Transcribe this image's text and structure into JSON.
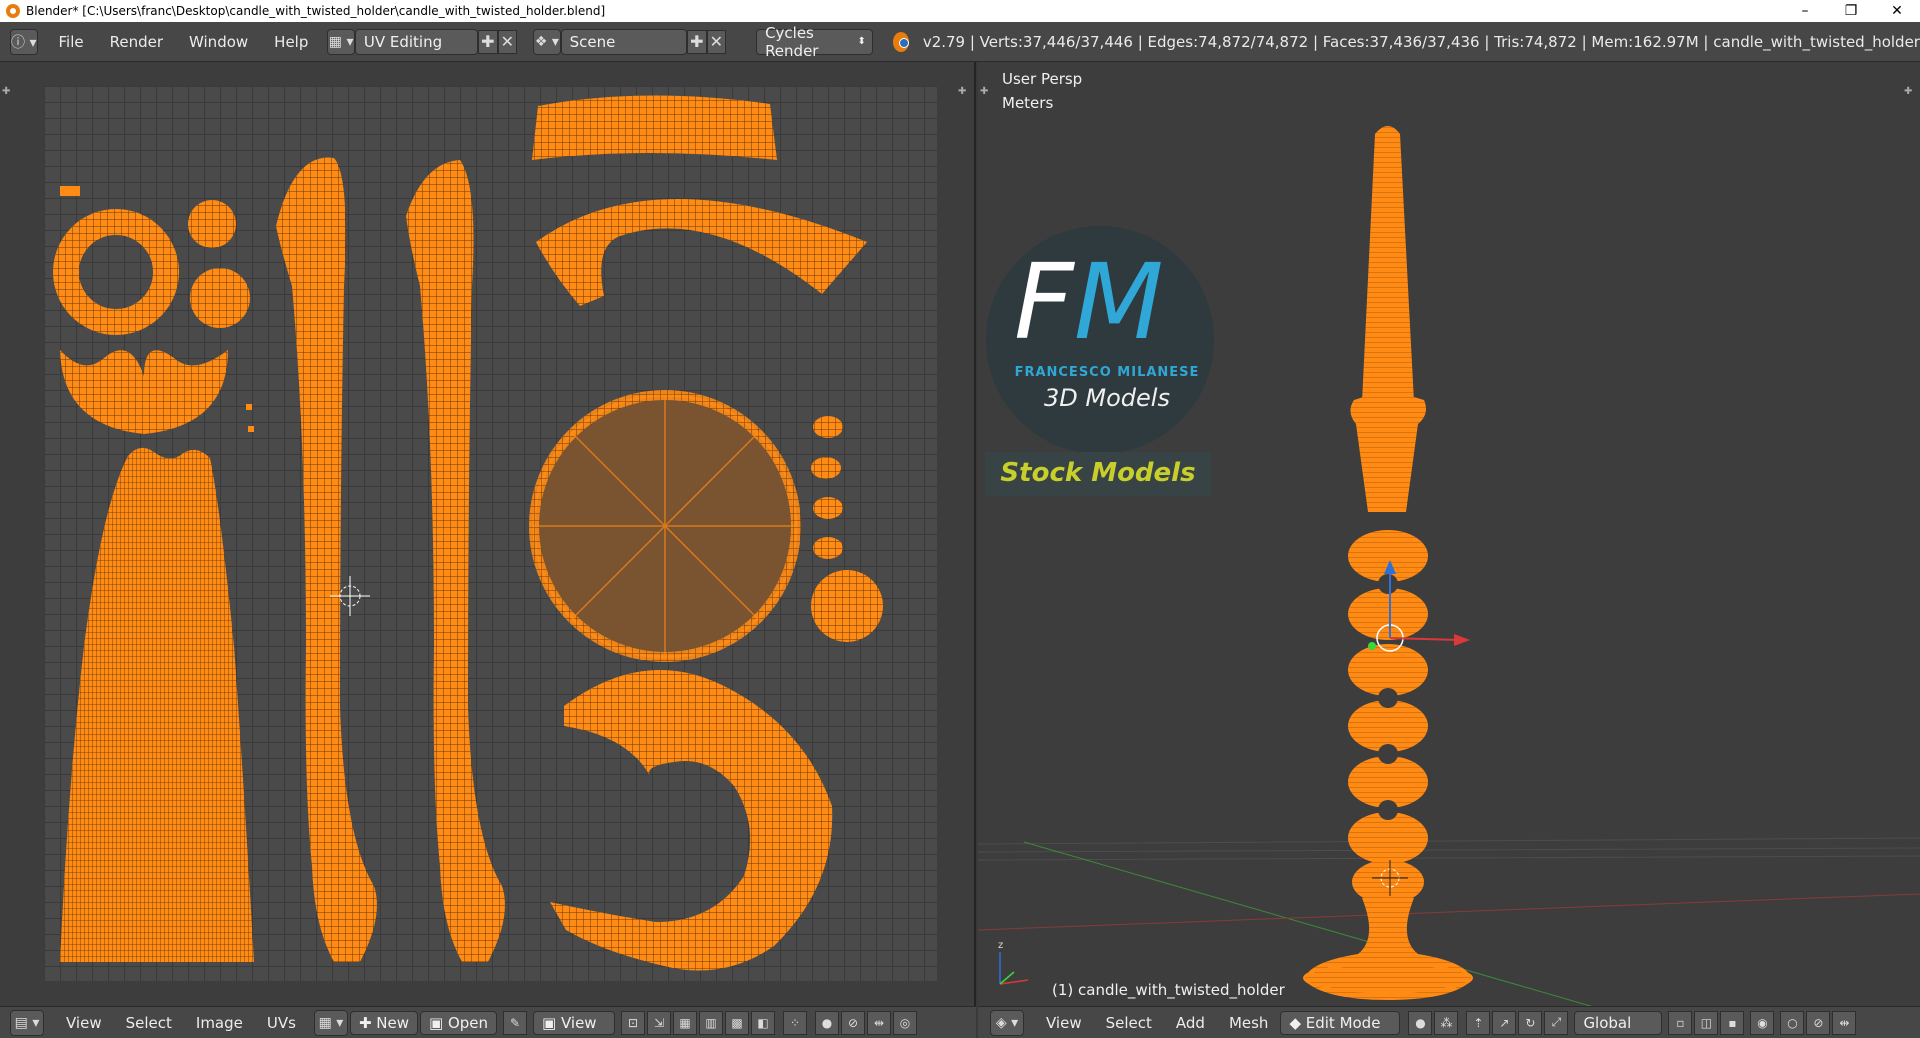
{
  "window": {
    "title": "Blender* [C:\\Users\\franc\\Desktop\\candle_with_twisted_holder\\candle_with_twisted_holder.blend]",
    "minimize": "–",
    "restore": "❐",
    "close": "✕"
  },
  "header": {
    "menus": [
      "File",
      "Render",
      "Window",
      "Help"
    ],
    "screen_layout": "UV Editing",
    "scene": "Scene",
    "render_engine": "Cycles Render",
    "stats": "v2.79 | Verts:37,446/37,446 | Edges:74,872/74,872 | Faces:37,436/37,436 | Tris:74,872 | Mem:162.97M | candle_with_twisted_holder"
  },
  "viewport": {
    "view_name": "User Persp",
    "units": "Meters",
    "object_label": "(1) candle_with_twisted_holder"
  },
  "watermark": {
    "logo_letters": "FM",
    "author": "FRANCESCO MILANESE",
    "subtitle": "3D Models",
    "badge": "Stock Models"
  },
  "uv_footer": {
    "menus": [
      "View",
      "Select",
      "Image",
      "UVs"
    ],
    "new_label": "New",
    "open_label": "Open",
    "view_label": "View"
  },
  "viewport_footer": {
    "menus": [
      "View",
      "Select",
      "Add",
      "Mesh"
    ],
    "mode": "Edit Mode",
    "orientation": "Global"
  },
  "colors": {
    "accent": "#ff8a14",
    "panel": "#474747",
    "grid": "#4a4a4a"
  }
}
